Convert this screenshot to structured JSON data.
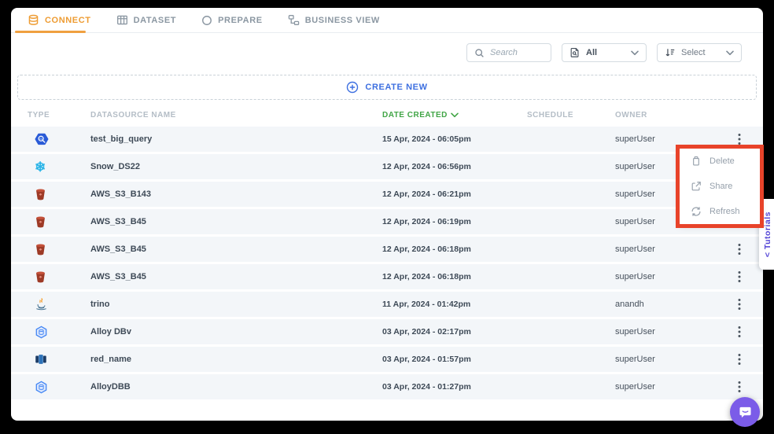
{
  "tabs": [
    {
      "label": "CONNECT",
      "icon": "database-icon",
      "active": true
    },
    {
      "label": "DATASET",
      "icon": "table-icon",
      "active": false
    },
    {
      "label": "PREPARE",
      "icon": "circle-icon",
      "active": false
    },
    {
      "label": "BUSINESS VIEW",
      "icon": "flow-icon",
      "active": false
    }
  ],
  "toolbar": {
    "search_placeholder": "Search",
    "file_filter_value": "All",
    "sort_value": "Select"
  },
  "create_new": {
    "label": "CREATE NEW"
  },
  "table": {
    "columns": [
      "TYPE",
      "DATASOURCE NAME",
      "DATE CREATED",
      "SCHEDULE",
      "OWNER"
    ],
    "sorted_column": "DATE CREATED",
    "sort_direction": "desc",
    "rows": [
      {
        "type_icon": "bigquery-icon",
        "name": "test_big_query",
        "date_created": "15 Apr, 2024 - 06:05pm",
        "schedule": "",
        "owner": "superUser"
      },
      {
        "type_icon": "snowflake-icon",
        "name": "Snow_DS22",
        "date_created": "12 Apr, 2024 - 06:56pm",
        "schedule": "",
        "owner": "superUser"
      },
      {
        "type_icon": "aws-s3-icon",
        "name": "AWS_S3_B143",
        "date_created": "12 Apr, 2024 - 06:21pm",
        "schedule": "",
        "owner": "superUser"
      },
      {
        "type_icon": "aws-s3-icon",
        "name": "AWS_S3_B45",
        "date_created": "12 Apr, 2024 - 06:19pm",
        "schedule": "",
        "owner": "superUser"
      },
      {
        "type_icon": "aws-s3-icon",
        "name": "AWS_S3_B45",
        "date_created": "12 Apr, 2024 - 06:18pm",
        "schedule": "",
        "owner": "superUser"
      },
      {
        "type_icon": "aws-s3-icon",
        "name": "AWS_S3_B45",
        "date_created": "12 Apr, 2024 - 06:18pm",
        "schedule": "",
        "owner": "superUser"
      },
      {
        "type_icon": "trino-icon",
        "name": "trino",
        "date_created": "11 Apr, 2024 - 01:42pm",
        "schedule": "",
        "owner": "anandh"
      },
      {
        "type_icon": "alloydb-icon",
        "name": "Alloy DBv",
        "date_created": "03 Apr, 2024 - 02:17pm",
        "schedule": "",
        "owner": "superUser"
      },
      {
        "type_icon": "redshift-icon",
        "name": "red_name",
        "date_created": "03 Apr, 2024 - 01:57pm",
        "schedule": "",
        "owner": "superUser"
      },
      {
        "type_icon": "alloydb-icon",
        "name": "AlloyDBB",
        "date_created": "03 Apr, 2024 - 01:27pm",
        "schedule": "",
        "owner": "superUser"
      }
    ]
  },
  "context_menu": {
    "items": [
      {
        "label": "Delete",
        "icon": "trash-icon"
      },
      {
        "label": "Share",
        "icon": "share-icon"
      },
      {
        "label": "Refresh",
        "icon": "refresh-icon"
      }
    ]
  },
  "tutorial_tab": {
    "chevron": "<",
    "label": "Tutorials"
  },
  "colors": {
    "active_tab_orange": "#ee9c33",
    "sorted_header_green": "#41a546",
    "create_new_blue": "#3d6fe0",
    "annotation_red": "#e8432a",
    "tutorial_purple": "#5142d6",
    "chat_fab_purple": "#7b5ce8",
    "row_background": "#f3f6f9"
  }
}
